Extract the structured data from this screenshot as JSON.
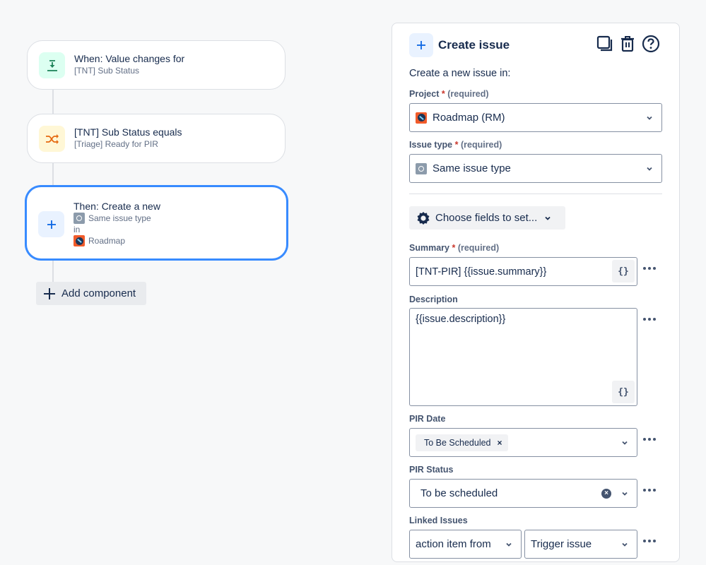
{
  "flow": {
    "trigger": {
      "title": "When: Value changes for",
      "subtitle": "[TNT] Sub Status",
      "icon": "field-value-changed-icon",
      "icon_bg": "#dcfff1",
      "icon_color": "#1f845a"
    },
    "condition": {
      "title": "[TNT] Sub Status equals",
      "subtitle": "[Triage] Ready for PIR",
      "icon": "shuffle-condition-icon",
      "icon_bg": "#fff7d6",
      "icon_color": "#e56910"
    },
    "action": {
      "title": "Then: Create a new",
      "issue_type": "Same issue type",
      "in_label": "in",
      "project": "Roadmap",
      "icon": "plus-icon",
      "icon_bg": "#e9f2ff",
      "icon_color": "#0c66e4"
    },
    "add_component_label": "Add component"
  },
  "panel": {
    "title": "Create issue",
    "actions": [
      "duplicate-icon",
      "trash-icon",
      "help-icon"
    ],
    "intro": "Create a new issue in:",
    "project": {
      "label": "Project",
      "required_text": "(required)",
      "value": "Roadmap (RM)"
    },
    "issue_type": {
      "label": "Issue type",
      "required_text": "(required)",
      "value": "Same issue type"
    },
    "choose_fields_label": "Choose fields to set...",
    "summary": {
      "label": "Summary",
      "required_text": "(required)",
      "value": "[TNT-PIR] {{issue.summary}}"
    },
    "description": {
      "label": "Description",
      "value": "{{issue.description}}"
    },
    "smart_value_button": "{}",
    "pir_date": {
      "label": "PIR Date",
      "tag": "To Be Scheduled",
      "tag_remove": "×"
    },
    "pir_status": {
      "label": "PIR Status",
      "value": "To be scheduled",
      "clear": "×"
    },
    "linked_issues": {
      "label": "Linked Issues",
      "link_type": "action item from",
      "target": "Trigger issue"
    }
  },
  "colors": {
    "accent": "#0c66e4",
    "selected_border": "#388bff",
    "required_star": "#c9372c"
  }
}
